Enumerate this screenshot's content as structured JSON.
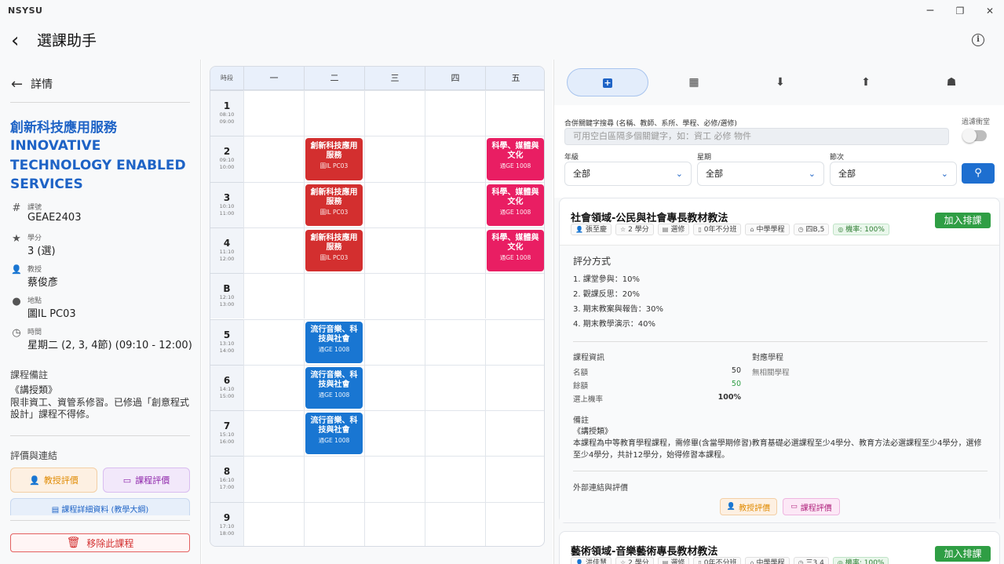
{
  "window": {
    "app_name": "NSYSU",
    "minimize": "─",
    "maximize": "❐",
    "close": "✕"
  },
  "header": {
    "back": "‹",
    "title": "選課助手",
    "info": "i"
  },
  "detail": {
    "heading": "詳情",
    "course_name_zh": "創新科技應用服務",
    "course_name_en": "INNOVATIVE TECHNOLOGY ENABLED SERVICES",
    "fields": [
      {
        "icon": "#",
        "key": "課號",
        "value": "GEAE2403"
      },
      {
        "icon": "★",
        "key": "學分",
        "value": "3 (選)"
      },
      {
        "icon": "👤",
        "key": "教授",
        "value": "蔡俊彥"
      },
      {
        "icon": "●",
        "key": "地點",
        "value": "圖IL PC03"
      },
      {
        "icon": "◷",
        "key": "時間",
        "value": "星期二 (2, 3, 4節) (09:10 - 12:00)"
      }
    ],
    "notes_title": "課程備註",
    "notes": "《講授類》\n限非資工、資管系修習。已修過「創意程式設計」課程不得修。",
    "ratings_title": "評價與連結",
    "prof_rating": "教授評價",
    "course_rating": "課程評價",
    "syllabus": "課程詳細資料 (教學大綱)",
    "remove": "移除此課程"
  },
  "timetable": {
    "corner": "時段",
    "days": [
      "一",
      "二",
      "三",
      "四",
      "五"
    ],
    "periods": [
      {
        "n": "1",
        "start": "08:10",
        "end": "09:00"
      },
      {
        "n": "2",
        "start": "09:10",
        "end": "10:00"
      },
      {
        "n": "3",
        "start": "10:10",
        "end": "11:00"
      },
      {
        "n": "4",
        "start": "11:10",
        "end": "12:00"
      },
      {
        "n": "B",
        "start": "12:10",
        "end": "13:00"
      },
      {
        "n": "5",
        "start": "13:10",
        "end": "14:00"
      },
      {
        "n": "6",
        "start": "14:10",
        "end": "15:00"
      },
      {
        "n": "7",
        "start": "15:10",
        "end": "16:00"
      },
      {
        "n": "8",
        "start": "16:10",
        "end": "17:00"
      },
      {
        "n": "9",
        "start": "17:10",
        "end": "18:00"
      }
    ],
    "blocks": [
      {
        "name": "創新科技應用服務",
        "room": "圖IL PC03",
        "color": "#d32f2f"
      },
      {
        "name": "科學、媒體與文化",
        "room": "通GE 1008",
        "color": "#e91e63"
      },
      {
        "name": "流行音樂、科技與社會",
        "room": "通GE 1008",
        "color": "#1976d2"
      }
    ]
  },
  "search": {
    "tabs": [
      "add-icon",
      "calendar-icon",
      "download-icon",
      "upload-icon",
      "robot-icon"
    ],
    "keyword_label": "合併關鍵字搜尋 (名稱、教師、系所、學程、必修/選修)",
    "keyword_placeholder": "可用空白區隔多個關鍵字，如：資工 必修 物件",
    "filter_label": "過濾衝堂",
    "grade_label": "年級",
    "grade_value": "全部",
    "weekday_label": "星期",
    "weekday_value": "全部",
    "period_label": "節次",
    "period_value": "全部"
  },
  "results": [
    {
      "title": "社會領域-公民與社會專長教材教法",
      "add": "加入排課",
      "chips": [
        {
          "icon": "👤",
          "text": "張至慶"
        },
        {
          "icon": "☆",
          "text": "2 學分"
        },
        {
          "icon": "▤",
          "text": "選修"
        },
        {
          "icon": "▯",
          "text": "0年不分班"
        },
        {
          "icon": "⌂",
          "text": "中學學程"
        },
        {
          "icon": "◷",
          "text": "四B,5"
        },
        {
          "icon": "◎",
          "text": "機率: 100%"
        }
      ],
      "grading_title": "評分方式",
      "grading": [
        "1. 課堂參與：10%",
        "2. 觀課反思：20%",
        "3. 期末教案與報告：30%",
        "4. 期末教學演示：40%"
      ],
      "info_title": "課程資訊",
      "program_title": "對應學程",
      "program_value": "無相關學程",
      "quota_key": "名額",
      "quota_val": "50",
      "remain_key": "餘額",
      "remain_val": "50",
      "prob_key": "選上機率",
      "prob_val": "100%",
      "note_title": "備註",
      "note": "《講授類》\n本課程為中等教育學程課程，需修畢(含當學期修習)教育基礎必選課程至少4學分、教育方法必選課程至少4學分，選修至少4學分，共計12學分，始得修習本課程。",
      "ext_title": "外部連結與評價",
      "prof_rating": "教授評價",
      "course_rating": "課程評價"
    },
    {
      "title": "藝術領域-音樂藝術專長教材教法",
      "add": "加入排課",
      "chips": [
        {
          "icon": "👤",
          "text": "洪佳慧"
        },
        {
          "icon": "☆",
          "text": "2 學分"
        },
        {
          "icon": "▤",
          "text": "選修"
        },
        {
          "icon": "▯",
          "text": "0年不分班"
        },
        {
          "icon": "⌂",
          "text": "中學學程"
        },
        {
          "icon": "◷",
          "text": "三3,4"
        },
        {
          "icon": "◎",
          "text": "機率: 100%"
        }
      ]
    }
  ]
}
